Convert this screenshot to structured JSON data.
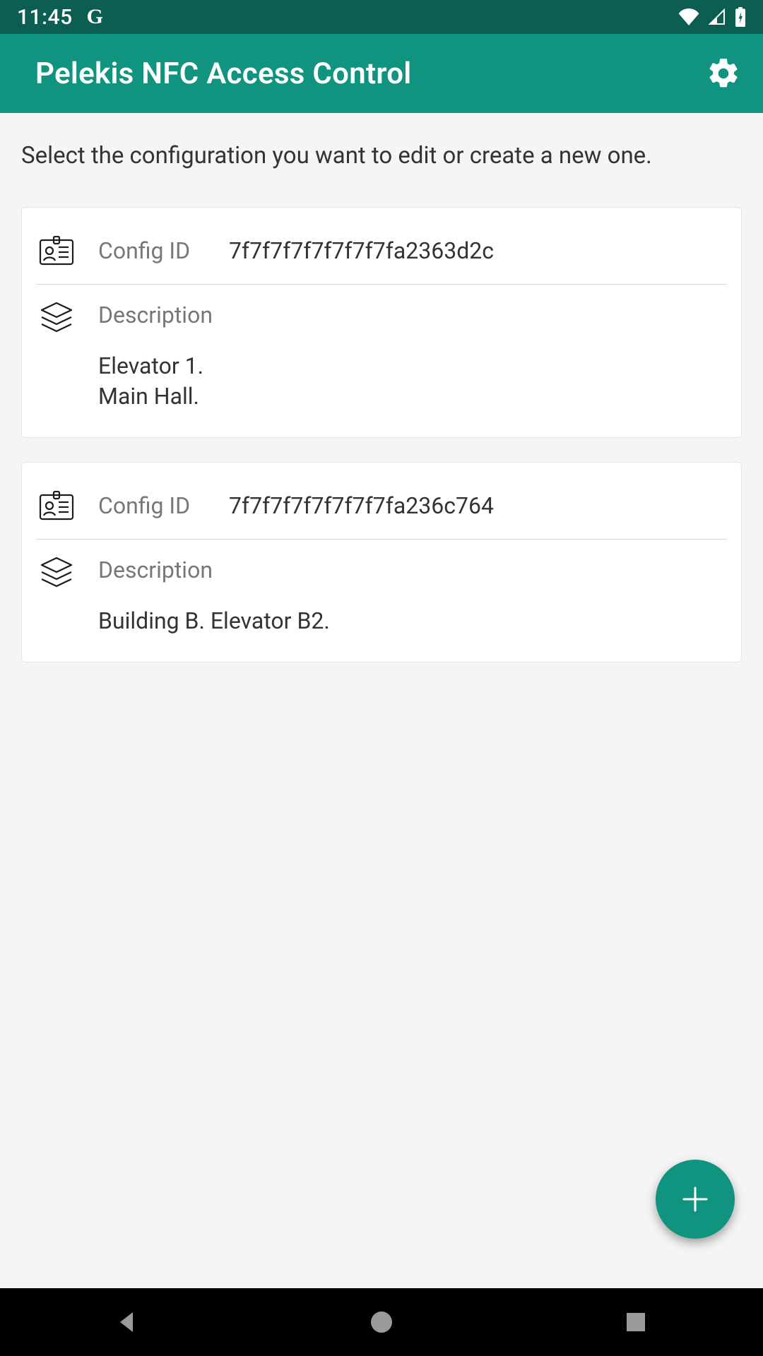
{
  "status": {
    "time": "11:45",
    "google_icon": "G"
  },
  "app": {
    "title": "Pelekis NFC Access Control"
  },
  "instruction": "Select the configuration you want to edit or create a new one.",
  "labels": {
    "config_id": "Config ID",
    "description": "Description"
  },
  "configs": [
    {
      "id": "7f7f7f7f7f7f7f7fa2363d2c",
      "description": "Elevator 1.\nMain Hall."
    },
    {
      "id": "7f7f7f7f7f7f7f7fa236c764",
      "description": "Building B. Elevator B2."
    }
  ],
  "colors": {
    "status_bar": "#0b5e50",
    "app_bar": "#109480",
    "background": "#f5f5f5",
    "card": "#ffffff",
    "fab": "#109480"
  }
}
